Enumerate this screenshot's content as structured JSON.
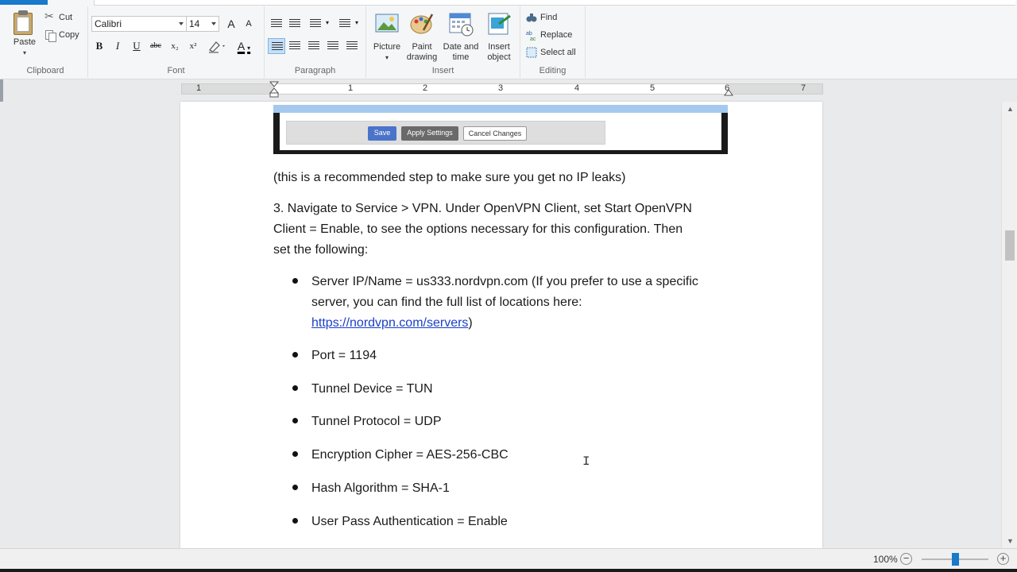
{
  "ribbon": {
    "clipboard": {
      "label": "Clipboard",
      "paste": "Paste",
      "cut": "Cut",
      "copy": "Copy"
    },
    "font": {
      "label": "Font",
      "family": "Calibri",
      "size": "14",
      "bold": "B",
      "italic": "I",
      "underline": "U",
      "strike": "abc",
      "subscript": "x₂",
      "superscript": "x²",
      "grow": "A",
      "shrink": "A"
    },
    "paragraph": {
      "label": "Paragraph"
    },
    "insert": {
      "label": "Insert",
      "picture": "Picture",
      "paint_drawing_1": "Paint",
      "paint_drawing_2": "drawing",
      "date_time_1": "Date and",
      "date_time_2": "time",
      "insert_object_1": "Insert",
      "insert_object_2": "object"
    },
    "editing": {
      "label": "Editing",
      "find": "Find",
      "replace": "Replace",
      "select_all": "Select all"
    }
  },
  "ruler": {
    "numbers": [
      "1",
      "1",
      "2",
      "3",
      "4",
      "5",
      "6",
      "7"
    ]
  },
  "embed": {
    "save": "Save",
    "apply": "Apply Settings",
    "cancel": "Cancel Changes"
  },
  "document": {
    "note": "(this is a recommended step to make sure you get no IP leaks)",
    "step3_line1": "3. Navigate to Service > VPN. Under OpenVPN Client, set Start OpenVPN",
    "step3_line2": "Client = Enable, to see the options necessary for this configuration. Then",
    "step3_line3": "set the following:",
    "bullet1_line1": "Server IP/Name = us333.nordvpn.com (If you prefer to use a specific",
    "bullet1_line2": "server, you can find the full list of locations here:",
    "bullet1_link": "https://nordvpn.com/servers",
    "bullet1_close": ")",
    "bullets": [
      "Port = 1194",
      "Tunnel Device = TUN",
      "Tunnel Protocol = UDP",
      "Encryption Cipher = AES-256-CBC",
      "Hash Algorithm = SHA-1",
      "User Pass Authentication = Enable"
    ]
  },
  "status": {
    "zoom": "100%",
    "zoom_out": "−",
    "zoom_in": "+"
  },
  "colors": {
    "accent": "#1979ca",
    "link": "#1a3fc8",
    "embed_save": "#4a73c9",
    "embed_apply": "#6a6a6a"
  }
}
